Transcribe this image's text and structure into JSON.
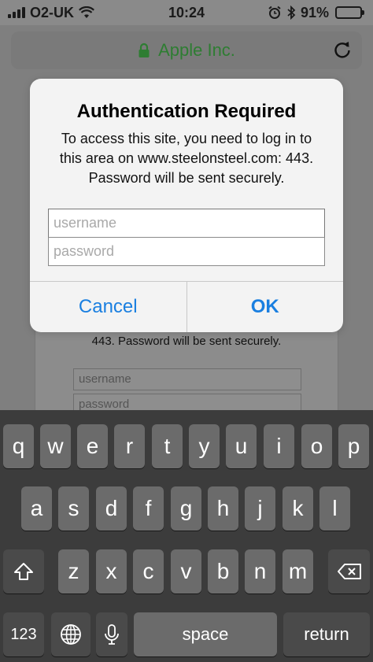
{
  "status_bar": {
    "carrier": "O2-UK",
    "time": "10:24",
    "battery_percent": "91%",
    "battery_level": 0.91,
    "icons": [
      "signal-bars-icon",
      "wifi-icon",
      "alarm-icon",
      "bluetooth-icon",
      "battery-icon"
    ]
  },
  "address_bar": {
    "site_name": "Apple Inc.",
    "icons": [
      "lock-icon",
      "reload-icon"
    ]
  },
  "background_page": {
    "message_tail": "443. Password will be sent securely.",
    "username_placeholder": "username",
    "password_placeholder": "password"
  },
  "dialog": {
    "title": "Authentication Required",
    "message": "To access this site, you need to log in to this area on www.steelonsteel.com: 443. Password will be sent securely.",
    "username_placeholder": "username",
    "password_placeholder": "password",
    "cancel_label": "Cancel",
    "ok_label": "OK"
  },
  "colors": {
    "accent": "#1a7fe0",
    "site_green": "#2e7d32",
    "battery_green": "#3fa535"
  },
  "keyboard": {
    "row1": [
      "q",
      "w",
      "e",
      "r",
      "t",
      "y",
      "u",
      "i",
      "o",
      "p"
    ],
    "row2": [
      "a",
      "s",
      "d",
      "f",
      "g",
      "h",
      "j",
      "k",
      "l"
    ],
    "row3": [
      "z",
      "x",
      "c",
      "v",
      "b",
      "n",
      "m"
    ],
    "numbers_label": "123",
    "space_label": "space",
    "return_label": "return",
    "icons": [
      "shift-icon",
      "backspace-icon",
      "globe-icon",
      "microphone-icon"
    ]
  }
}
